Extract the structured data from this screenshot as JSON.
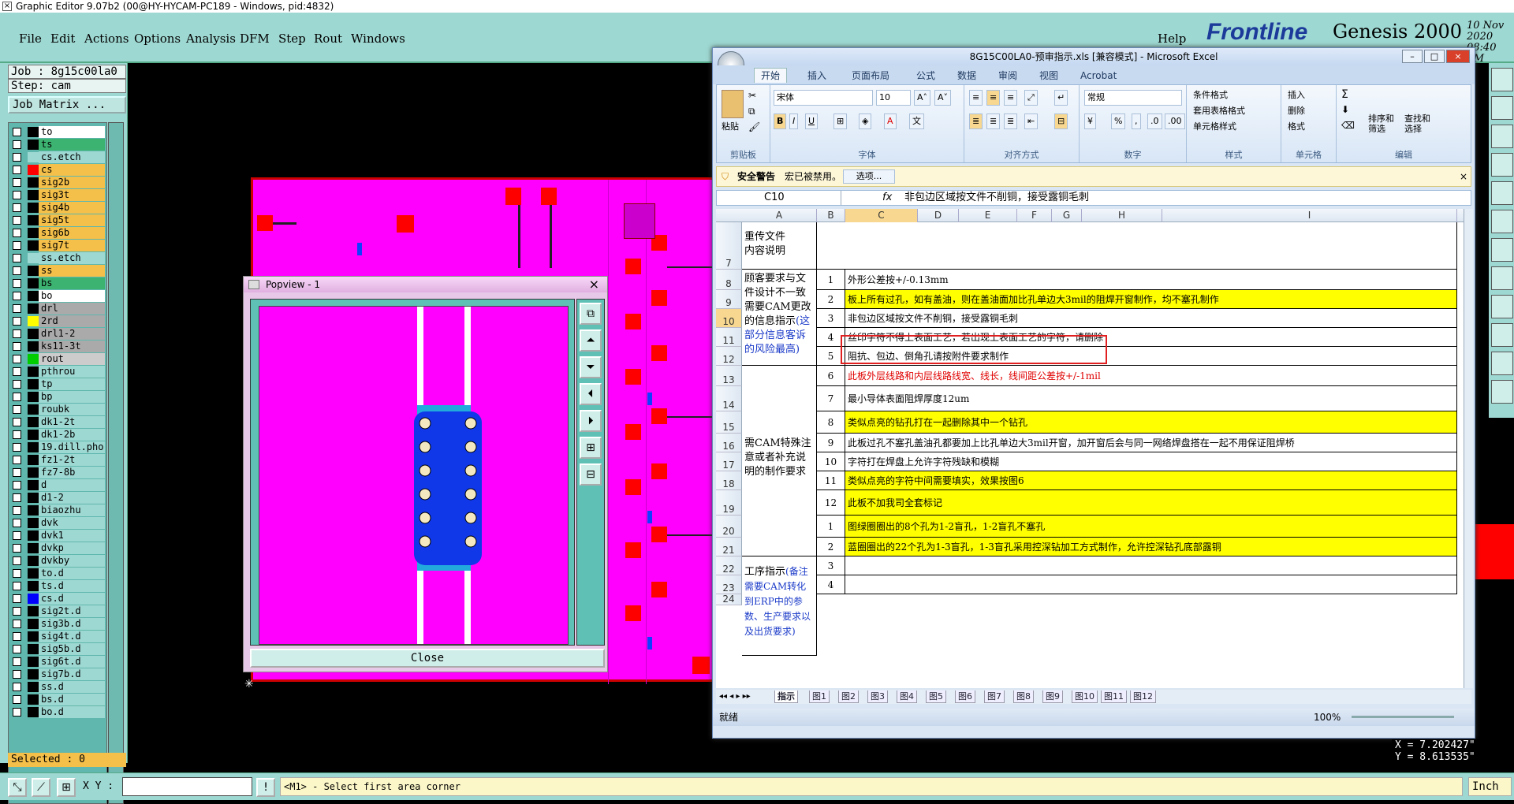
{
  "app": {
    "title": "Graphic Editor 9.07b2 (00@HY-HYCAM-PC189 - Windows, pid:4832)",
    "menu": [
      "File",
      "Edit",
      "Actions",
      "Options",
      "Analysis",
      "DFM",
      "Step",
      "Rout",
      "Windows"
    ],
    "help": "Help",
    "brand": "Frontline",
    "product": "Genesis 2000",
    "date": "10 Nov 2020",
    "time": "08:40 PM"
  },
  "job": {
    "job_label": "Job : 8g15c00la0",
    "step_label": "Step: cam",
    "matrix_button": "Job Matrix ...",
    "layers": [
      {
        "name": "to",
        "color": "#ffffff",
        "sw": "#000000"
      },
      {
        "name": "ts",
        "color": "#3cb371",
        "sw": "#000000"
      },
      {
        "name": "cs.etch",
        "color": "#9ed8d2",
        "sw": "#9ed8d2"
      },
      {
        "name": "cs",
        "color": "#f4c04a",
        "sw": "#ff0000"
      },
      {
        "name": "sig2b",
        "color": "#f4c04a",
        "sw": "#000000"
      },
      {
        "name": "sig3t",
        "color": "#f4c04a",
        "sw": "#000000"
      },
      {
        "name": "sig4b",
        "color": "#f4c04a",
        "sw": "#000000"
      },
      {
        "name": "sig5t",
        "color": "#f4c04a",
        "sw": "#000000"
      },
      {
        "name": "sig6b",
        "color": "#f4c04a",
        "sw": "#000000"
      },
      {
        "name": "sig7t",
        "color": "#f4c04a",
        "sw": "#000000"
      },
      {
        "name": "ss.etch",
        "color": "#9ed8d2",
        "sw": "#9ed8d2"
      },
      {
        "name": "ss",
        "color": "#f4c04a",
        "sw": "#000000"
      },
      {
        "name": "bs",
        "color": "#3cb371",
        "sw": "#000000"
      },
      {
        "name": "bo",
        "color": "#ffffff",
        "sw": "#000000"
      },
      {
        "name": "drl",
        "color": "#aaaaaa",
        "sw": "#000000"
      },
      {
        "name": "2rd",
        "color": "#aaaaaa",
        "sw": "#ffff00"
      },
      {
        "name": "drl1-2",
        "color": "#aaaaaa",
        "sw": "#000000"
      },
      {
        "name": "ks11-3t",
        "color": "#aaaaaa",
        "sw": "#000000"
      },
      {
        "name": "rout",
        "color": "#cccccc",
        "sw": "#00cc00"
      },
      {
        "name": "pthrou",
        "color": "#9ed8d2",
        "sw": "#000000"
      },
      {
        "name": "tp",
        "color": "#9ed8d2",
        "sw": "#000000"
      },
      {
        "name": "bp",
        "color": "#9ed8d2",
        "sw": "#000000"
      },
      {
        "name": "roubk",
        "color": "#9ed8d2",
        "sw": "#000000"
      },
      {
        "name": "dk1-2t",
        "color": "#9ed8d2",
        "sw": "#000000"
      },
      {
        "name": "dk1-2b",
        "color": "#9ed8d2",
        "sw": "#000000"
      },
      {
        "name": "19.dill.pho",
        "color": "#9ed8d2",
        "sw": "#000000"
      },
      {
        "name": "fz1-2t",
        "color": "#9ed8d2",
        "sw": "#000000"
      },
      {
        "name": "fz7-8b",
        "color": "#9ed8d2",
        "sw": "#000000"
      },
      {
        "name": "d",
        "color": "#9ed8d2",
        "sw": "#000000"
      },
      {
        "name": "d1-2",
        "color": "#9ed8d2",
        "sw": "#000000"
      },
      {
        "name": "biaozhu",
        "color": "#9ed8d2",
        "sw": "#000000"
      },
      {
        "name": "dvk",
        "color": "#9ed8d2",
        "sw": "#000000"
      },
      {
        "name": "dvk1",
        "color": "#9ed8d2",
        "sw": "#000000"
      },
      {
        "name": "dvkp",
        "color": "#9ed8d2",
        "sw": "#000000"
      },
      {
        "name": "dvkby",
        "color": "#9ed8d2",
        "sw": "#000000"
      },
      {
        "name": "to.d",
        "color": "#9ed8d2",
        "sw": "#000000"
      },
      {
        "name": "ts.d",
        "color": "#9ed8d2",
        "sw": "#000000"
      },
      {
        "name": "cs.d",
        "color": "#9ed8d2",
        "sw": "#0000ff"
      },
      {
        "name": "sig2t.d",
        "color": "#9ed8d2",
        "sw": "#000000"
      },
      {
        "name": "sig3b.d",
        "color": "#9ed8d2",
        "sw": "#000000"
      },
      {
        "name": "sig4t.d",
        "color": "#9ed8d2",
        "sw": "#000000"
      },
      {
        "name": "sig5b.d",
        "color": "#9ed8d2",
        "sw": "#000000"
      },
      {
        "name": "sig6t.d",
        "color": "#9ed8d2",
        "sw": "#000000"
      },
      {
        "name": "sig7b.d",
        "color": "#9ed8d2",
        "sw": "#000000"
      },
      {
        "name": "ss.d",
        "color": "#9ed8d2",
        "sw": "#000000"
      },
      {
        "name": "bs.d",
        "color": "#9ed8d2",
        "sw": "#000000"
      },
      {
        "name": "bo.d",
        "color": "#9ed8d2",
        "sw": "#000000"
      }
    ],
    "selected": "Selected : 0"
  },
  "status": {
    "xy_label": "X Y :",
    "xy_value": "",
    "prompt": "<M1> - Select first area corner",
    "units": "Inch",
    "x_coord": "X = 7.202427\"",
    "y_coord": "Y = 8.613535\""
  },
  "popview": {
    "title": "Popview - 1",
    "close": "Close"
  },
  "excel": {
    "title": "8G15C00LA0-预审指示.xls  [兼容模式] - Microsoft Excel",
    "tabs": [
      "开始",
      "插入",
      "页面布局",
      "公式",
      "数据",
      "审阅",
      "视图",
      "Acrobat"
    ],
    "clipboard": {
      "paste": "粘贴",
      "label": "剪贴板"
    },
    "font": {
      "name": "宋体",
      "size": "10",
      "label": "字体",
      "bold": "B",
      "italic": "I",
      "underline": "U"
    },
    "align_label": "对齐方式",
    "number": {
      "format": "常规",
      "label": "数字",
      "percent": "%"
    },
    "styles": {
      "cond": "条件格式",
      "table": "套用表格格式",
      "cell": "单元格样式",
      "label": "样式"
    },
    "cells": {
      "insert": "插入",
      "delete": "删除",
      "format": "格式",
      "label": "单元格"
    },
    "edit": {
      "sort": "排序和\n筛选",
      "find": "查找和\n选择",
      "label": "编辑"
    },
    "security": {
      "label": "安全警告",
      "text": "宏已被禁用。",
      "options": "选项..."
    },
    "name_box": "C10",
    "fx": "fx",
    "formula": "非包边区域按文件不削铜，接受露铜毛刺",
    "columns": [
      "A",
      "B",
      "C",
      "D",
      "E",
      "F",
      "G",
      "H",
      "I"
    ],
    "rows": [
      "7",
      "8",
      "9",
      "10",
      "11",
      "12",
      "13",
      "14",
      "15",
      "16",
      "17",
      "18",
      "19",
      "20",
      "21",
      "22",
      "23",
      "24"
    ],
    "section_reupload": "重传文件\n内容说明",
    "section1": {
      "black": "顾客要求与文件设计不一致需要CAM更改的信息指示",
      "blue": "(这部分信息客诉的风险最高)"
    },
    "section2": "需CAM特殊注意或者补充说明的制作要求",
    "section3": {
      "black": "工序指示",
      "blue": "(备注需要CAM转化到ERP中的参数、生产要求以及出货要求)"
    },
    "items": [
      {
        "n": "1",
        "t": "外形公差按+/-0.13mm",
        "style": ""
      },
      {
        "n": "2",
        "t": "板上所有过孔，如有盖油，则在盖油面加比孔单边大3mil的阻焊开窗制作，均不塞孔制作",
        "style": "ylw"
      },
      {
        "n": "3",
        "t": "非包边区域按文件不削铜，接受露铜毛刺",
        "style": ""
      },
      {
        "n": "4",
        "t": "丝印字符不得上表面工艺，若出现上表面工艺的字符，请删除",
        "style": ""
      },
      {
        "n": "5",
        "t": "阻抗、包边、倒角孔请按附件要求制作",
        "style": ""
      },
      {
        "n": "6",
        "t": "此板外层线路和内层线路线宽、线长，线间距公差按+/-1mil",
        "style": "red"
      },
      {
        "n": "7",
        "t": "最小导体表面阻焊厚度12um",
        "style": ""
      },
      {
        "n": "8",
        "t": "类似点亮的钻孔打在一起删除其中一个钻孔",
        "style": "ylw"
      },
      {
        "n": "9",
        "t": "此板过孔不塞孔盖油孔都要加上比孔单边大3mil开窗，加开窗后会与同一网络焊盘搭在一起不用保证阻焊桥",
        "style": ""
      },
      {
        "n": "10",
        "t": "字符打在焊盘上允许字符残缺和模糊",
        "style": ""
      },
      {
        "n": "11",
        "t": "类似点亮的字符中间需要填实，效果按图6",
        "style": "ylw"
      },
      {
        "n": "12",
        "t": "此板不加我司全套标记",
        "style": "ylw"
      },
      {
        "n": "1",
        "t": "图绿圈圈出的8个孔为1-2盲孔，1-2盲孔不塞孔",
        "style": "ylw"
      },
      {
        "n": "2",
        "t": "蓝圈圈出的22个孔为1-3盲孔，1-3盲孔采用控深钻加工方式制作，允许控深钻孔底部露铜",
        "style": "ylw"
      },
      {
        "n": "3",
        "t": "",
        "style": ""
      },
      {
        "n": "4",
        "t": "",
        "style": ""
      }
    ],
    "sheet_tabs": [
      "指示",
      "图1",
      "图2",
      "图3",
      "图4",
      "图5",
      "图6",
      "图7",
      "图8",
      "图9",
      "图10",
      "图11",
      "图12"
    ],
    "status": "就绪",
    "zoom": "100%"
  }
}
